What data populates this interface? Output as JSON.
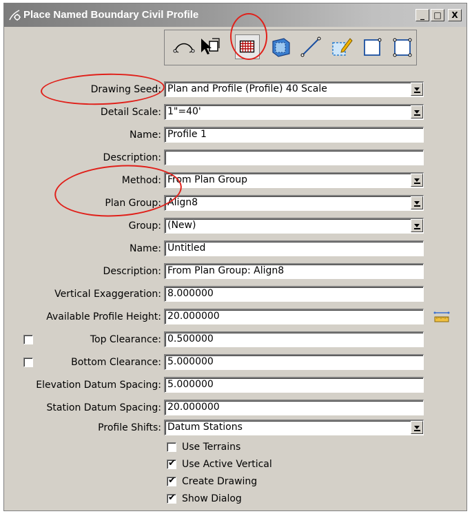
{
  "window": {
    "title": "Place Named Boundary Civil Profile",
    "buttons": {
      "minimize": "_",
      "maximize": "□",
      "close": "X"
    }
  },
  "toolbar": {
    "tools": [
      {
        "icon": "civil-stroking-icon",
        "selected": false
      },
      {
        "icon": "from-element-icon",
        "selected": false
      },
      {
        "icon": "profile-grid-icon",
        "selected": true
      },
      {
        "icon": "cross-section-icon",
        "selected": false
      },
      {
        "icon": "line-icon",
        "selected": false
      },
      {
        "icon": "edit-boundary-icon",
        "selected": false
      },
      {
        "icon": "shape-icon",
        "selected": false
      },
      {
        "icon": "resize-shape-icon",
        "selected": false
      }
    ]
  },
  "form": {
    "drawing_seed": {
      "label": "Drawing Seed:",
      "value": "Plan and Profile (Profile) 40 Scale"
    },
    "detail_scale": {
      "label": "Detail Scale:",
      "value": "1\"=40'"
    },
    "name": {
      "label": "Name:",
      "value": "Profile 1"
    },
    "description": {
      "label": "Description:",
      "value": ""
    },
    "method": {
      "label": "Method:",
      "value": "From Plan Group"
    },
    "plan_group": {
      "label": "Plan Group:",
      "value": "Align8"
    },
    "group": {
      "label": "Group:",
      "value": "(New)"
    },
    "group_name": {
      "label": "Name:",
      "value": "Untitled"
    },
    "group_description": {
      "label": "Description:",
      "value": "From Plan Group: Align8"
    },
    "vertical_exaggeration": {
      "label": "Vertical Exaggeration:",
      "value": "8.000000"
    },
    "available_profile_height": {
      "label": "Available Profile Height:",
      "value": "20.000000"
    },
    "top_clearance": {
      "label": "Top Clearance:",
      "value": "0.500000",
      "checked": false
    },
    "bottom_clearance": {
      "label": "Bottom Clearance:",
      "value": "5.000000",
      "checked": false
    },
    "elevation_datum_spacing": {
      "label": "Elevation Datum Spacing:",
      "value": "5.000000"
    },
    "station_datum_spacing": {
      "label": "Station Datum Spacing:",
      "value": "20.000000"
    },
    "profile_shifts": {
      "label": "Profile Shifts:",
      "value": "Datum Stations"
    }
  },
  "options": {
    "use_terrains": {
      "label": "Use Terrains",
      "checked": false
    },
    "use_active_vertical": {
      "label": "Use Active Vertical",
      "checked": true
    },
    "create_drawing": {
      "label": "Create Drawing",
      "checked": true
    },
    "show_dialog": {
      "label": "Show Dialog",
      "checked": true
    }
  },
  "colors": {
    "annotation": "#e0201a",
    "titlebar": "#8a8a8a",
    "dialog_bg": "#d4d0c8"
  }
}
